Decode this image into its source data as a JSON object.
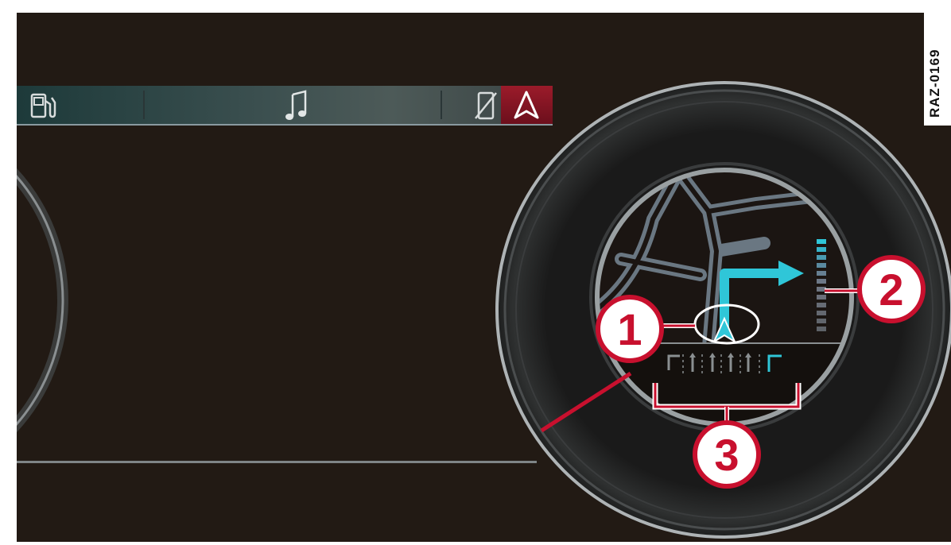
{
  "header_tabs": [
    {
      "name": "fuel",
      "icon": "fuel-pump-icon"
    },
    {
      "name": "media",
      "icon": "music-note-icon"
    },
    {
      "name": "phone",
      "icon": "phone-crossed-icon"
    },
    {
      "name": "navigation",
      "icon": "navigation-arrow-icon",
      "active": true
    }
  ],
  "callouts": {
    "c1": "1",
    "c2": "2",
    "c3": "3"
  },
  "figure_code": "RAZ-0169",
  "colors": {
    "screen_bg": "#221a14",
    "accent_red": "#c8102e",
    "route_cyan": "#2fc6d8",
    "active_tab": "#8e1424"
  }
}
